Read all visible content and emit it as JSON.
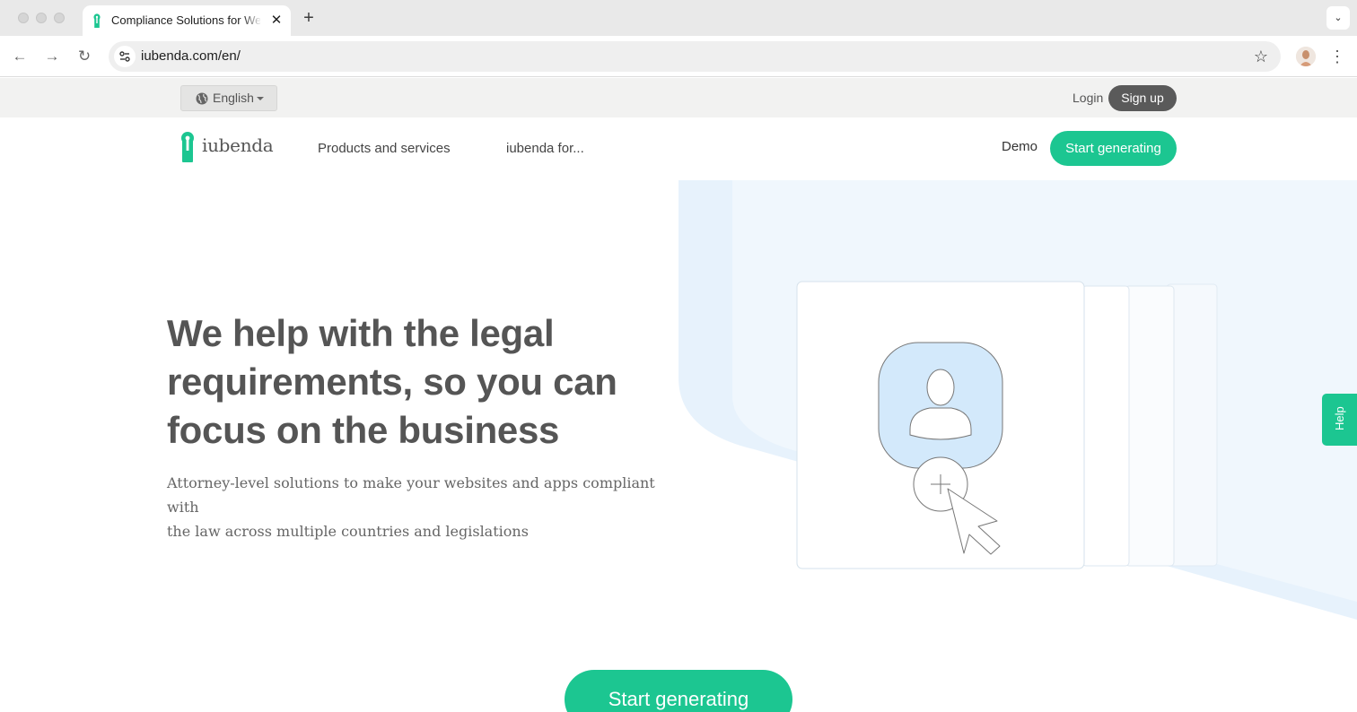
{
  "browser": {
    "tab": {
      "title": "Compliance Solutions for Websites and Apps",
      "close": "✕"
    },
    "new_tab": "+",
    "tab_menu": "⌄",
    "url": "iubenda.com/en/",
    "nav": {
      "back": "←",
      "forward": "→",
      "reload": "↻"
    },
    "star": "☆",
    "menu": "⋮"
  },
  "topstrip": {
    "language": "English",
    "login": "Login",
    "signup": "Sign up"
  },
  "header": {
    "logo_text": "iubenda",
    "nav": [
      "Products and services",
      "iubenda for..."
    ],
    "demo": "Demo",
    "cta": "Start generating"
  },
  "hero": {
    "headline_lines": [
      "We help with the legal",
      "requirements, so you can",
      "focus on the business"
    ],
    "subline_lines": [
      "Attorney-level solutions to make your websites and apps compliant with",
      "the law across multiple countries and legislations"
    ],
    "cta": "Start generating"
  },
  "help": {
    "label": "Help"
  },
  "colors": {
    "brand_green": "#1cc691",
    "text_gray": "#555555",
    "hero_blue": "#e7f2fc"
  }
}
